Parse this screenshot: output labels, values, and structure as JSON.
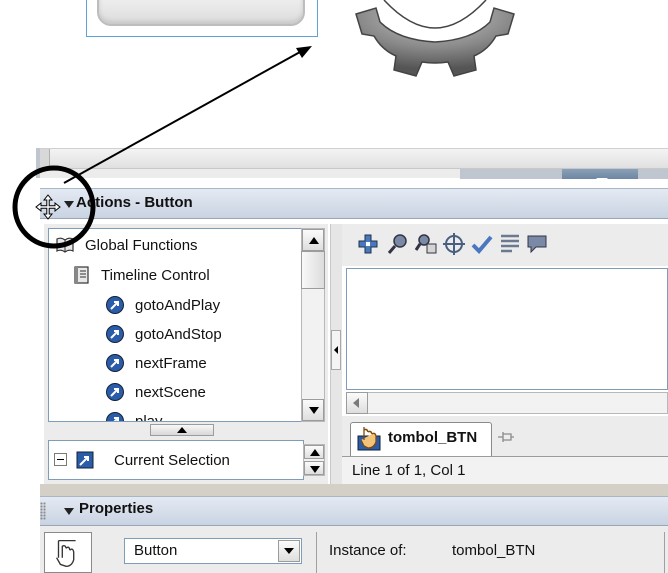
{
  "actions_panel": {
    "title": "Actions - Button"
  },
  "actions_toolbox": {
    "items": [
      {
        "label": "Global Functions",
        "icon": "book-open-icon",
        "level": 0
      },
      {
        "label": "Timeline Control",
        "icon": "book-icon",
        "level": 1
      },
      {
        "label": "gotoAndPlay",
        "icon": "action-arrow-icon",
        "level": 2
      },
      {
        "label": "gotoAndStop",
        "icon": "action-arrow-icon",
        "level": 2
      },
      {
        "label": "nextFrame",
        "icon": "action-arrow-icon",
        "level": 2
      },
      {
        "label": "nextScene",
        "icon": "action-arrow-icon",
        "level": 2
      },
      {
        "label": "play",
        "icon": "action-arrow-icon",
        "level": 2
      }
    ],
    "scope": {
      "label": "Current Selection"
    }
  },
  "script_toolbar": {
    "icons": [
      "add-statement-icon",
      "find-icon",
      "replace-icon",
      "target-path-icon",
      "check-syntax-icon",
      "auto-format-icon",
      "code-hint-icon"
    ]
  },
  "script_tab": {
    "label": "tombol_BTN"
  },
  "status_bar": {
    "text": "Line 1 of 1, Col 1"
  },
  "properties_panel": {
    "title": "Properties",
    "symbol_type": "Button",
    "instance_label": "Instance of:",
    "instance_value": "tombol_BTN"
  },
  "colors": {
    "panel_header": "#c9d3e2",
    "panel_body": "#ececec",
    "field_border": "#7f9db9",
    "action_icon": "#2a5caa"
  }
}
